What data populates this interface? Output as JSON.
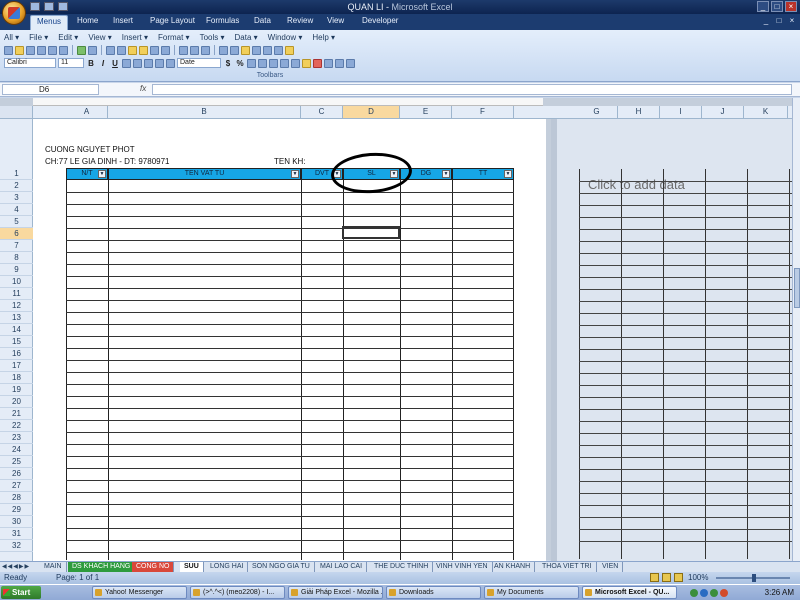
{
  "window": {
    "title_doc": "QUAN LI",
    "title_sep": " - ",
    "title_app": "Microsoft Excel",
    "minimize": "_",
    "restore": "□",
    "close": "×"
  },
  "ribbon_tabs": [
    "Menus",
    "Home",
    "Insert",
    "Page Layout",
    "Formulas",
    "Data",
    "Review",
    "View",
    "Developer"
  ],
  "menu_bar": [
    "All ▾",
    "File ▾",
    "Edit ▾",
    "View ▾",
    "Insert ▾",
    "Format ▾",
    "Tools ▾",
    "Data ▾",
    "Window ▾",
    "Help ▾"
  ],
  "toolbar": {
    "font_name": "Calibri",
    "font_size": "11",
    "bold": "B",
    "italic": "I",
    "underline": "U",
    "number_format": "Date",
    "currency": "$",
    "percent": "%",
    "group_label": "Toolbars"
  },
  "formula_bar": {
    "name_box": "D6",
    "fx": "fx",
    "value": ""
  },
  "columns_left": [
    "A",
    "B",
    "C",
    "D",
    "E",
    "F"
  ],
  "columns_right": [
    "G",
    "H",
    "I",
    "J",
    "K"
  ],
  "selected_column": "D",
  "selected_row": 6,
  "rows": [
    "1",
    "2",
    "3",
    "4",
    "5",
    "6",
    "7",
    "8",
    "9",
    "10",
    "11",
    "12",
    "13",
    "14",
    "15",
    "16",
    "17",
    "18",
    "19",
    "20",
    "21",
    "22",
    "23",
    "24",
    "25",
    "26",
    "27",
    "28",
    "29",
    "30",
    "31",
    "32"
  ],
  "sheet_header": {
    "company": "CUONG NGUYET PHOT",
    "address": "CH:77 LE GIA DINH - DT: 9780971",
    "customer_label": "TEN KH:"
  },
  "table_headers": [
    "N/T",
    "TEN VAT TU",
    "DVT",
    "SL",
    "DG",
    "TT"
  ],
  "placeholder_text": "Click to add data",
  "sheet_tabs": [
    "MAIN",
    "DS KHACH HANG",
    "CONG NO",
    "SUU",
    "LONG HAI",
    "SON NGO GIA TU",
    "MAI LAO CAI",
    "THE DUC THINH",
    "VINH VINH YEN",
    "AN KHANH",
    "THOA VIET TRI",
    "VIEN"
  ],
  "active_sheet": "SUU",
  "status": {
    "ready": "Ready",
    "page": "Page: 1 of 1",
    "zoom": "100%"
  },
  "taskbar": {
    "start": "Start",
    "tasks": [
      "Yahoo! Messenger",
      "(>^.^<) (meo2208) - I...",
      "Giải Pháp Excel - Mozilla ...",
      "Downloads",
      "My Documents",
      "Microsoft Excel - QU..."
    ],
    "clock": "3:26 AM"
  }
}
